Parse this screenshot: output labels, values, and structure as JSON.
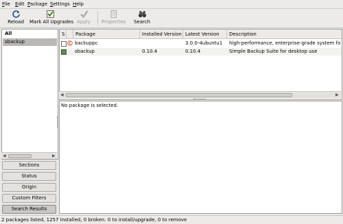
{
  "menubar": {
    "items": [
      {
        "label": "File",
        "key": "F",
        "rest": "ile"
      },
      {
        "label": "Edit",
        "key": "E",
        "rest": "dit"
      },
      {
        "label": "Package",
        "key": "P",
        "rest": "ackage"
      },
      {
        "label": "Settings",
        "key": "S",
        "rest": "ettings"
      },
      {
        "label": "Help",
        "key": "H",
        "rest": "elp"
      }
    ]
  },
  "toolbar": {
    "reload": "Reload",
    "mark_all": "Mark All Upgrades",
    "apply": "Apply",
    "properties": "Properties",
    "search": "Search"
  },
  "sidebar": {
    "list": [
      {
        "label": "All"
      },
      {
        "label": "sbackup"
      }
    ],
    "buttons": [
      {
        "label": "Sections"
      },
      {
        "label": "Status"
      },
      {
        "label": "Origin"
      },
      {
        "label": "Custom Filters"
      },
      {
        "label": "Search Results"
      }
    ]
  },
  "table": {
    "headers": [
      "S",
      "",
      "Package",
      "Installed Version",
      "Latest Version",
      "Description"
    ],
    "rows": [
      {
        "package": "backuppc",
        "installed": "",
        "latest": "3.0.0-4ubuntu1",
        "description": "high-performance, enterprise-grade system for back",
        "status": "not-installed"
      },
      {
        "package": "sbackup",
        "installed": "0.10.4",
        "latest": "0.10.4",
        "description": "Simple Backup Suite for desktop use",
        "status": "installed"
      }
    ]
  },
  "details": {
    "text": "No package is selected."
  },
  "status": {
    "text": "2 packages listed, 1257 installed, 0 broken. 0 to install/upgrade, 0 to remove"
  },
  "colors": {
    "installed_box": "#5d8a4e",
    "selection": "#b9b8b5"
  }
}
